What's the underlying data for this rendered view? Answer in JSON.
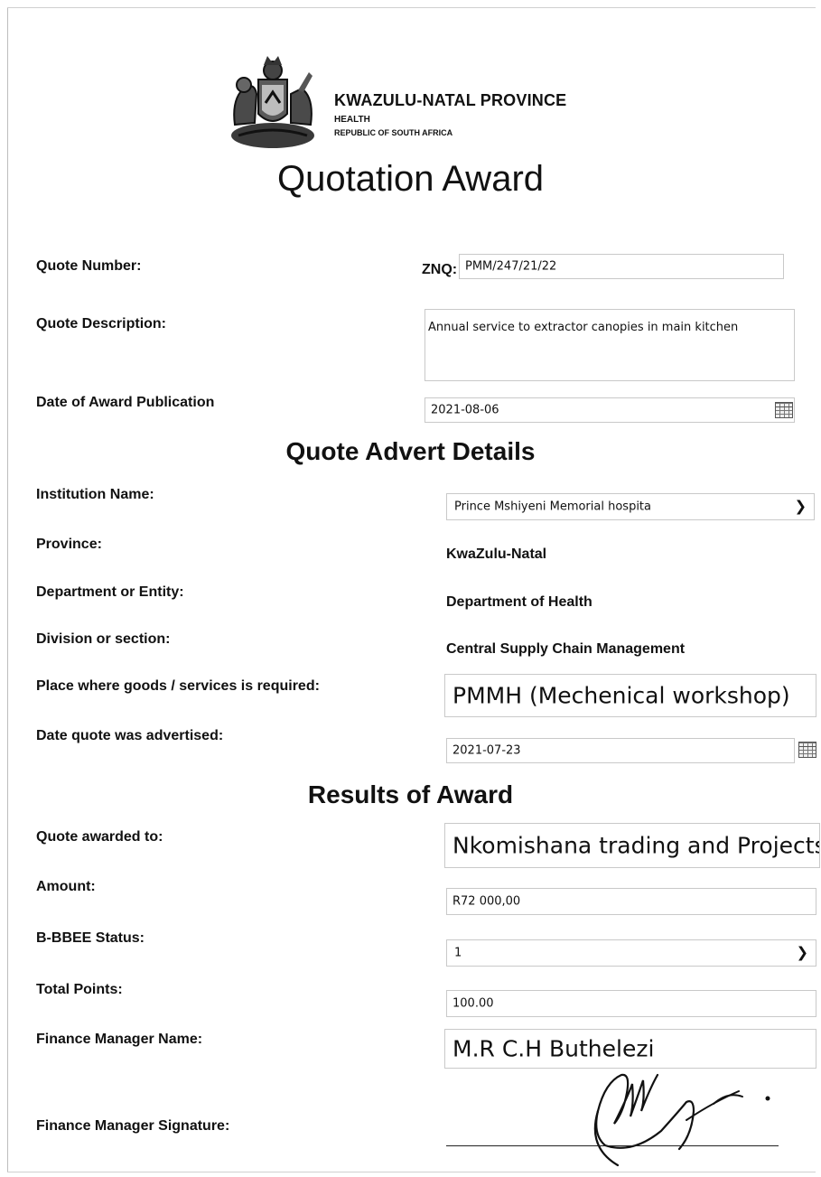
{
  "header": {
    "province": "KWAZULU-NATAL PROVINCE",
    "department": "HEALTH",
    "country": "REPUBLIC OF SOUTH AFRICA",
    "logo_icon": "coat-of-arms-icon"
  },
  "title": "Quotation Award",
  "quote": {
    "number_label": "Quote Number:",
    "number_prefix": "ZNQ:",
    "number_value": "PMM/247/21/22",
    "description_label": "Quote Description:",
    "description_value": "Annual service to extractor canopies in main kitchen",
    "award_date_label": "Date of Award Publication",
    "award_date_value": "2021-08-06"
  },
  "advert": {
    "heading": "Quote Advert Details",
    "institution_label": "Institution Name:",
    "institution_value": "Prince Mshiyeni Memorial hospita",
    "province_label": "Province:",
    "province_value": "KwaZulu-Natal",
    "department_label": "Department or Entity:",
    "department_value": "Department of Health",
    "division_label": "Division or section:",
    "division_value": "Central Supply Chain Management",
    "place_label": "Place where goods /  services is required:",
    "place_value": "PMMH (Mechenical workshop)",
    "advertised_label": "Date quote was advertised:",
    "advertised_value": "2021-07-23"
  },
  "results": {
    "heading": "Results of Award",
    "awarded_label": "Quote awarded to:",
    "awarded_value": "Nkomishana trading and Projects",
    "amount_label": "Amount:",
    "amount_value": "R72 000,00",
    "bbbee_label": "B-BBEE Status:",
    "bbbee_value": "1",
    "points_label": "Total Points:",
    "points_value": "100.00",
    "fm_name_label": "Finance Manager Name:",
    "fm_name_value": "M.R C.H Buthelezi",
    "fm_signature_label": "Finance Manager Signature:"
  },
  "icons": {
    "calendar": "calendar-icon",
    "dropdown": "chevron-down-icon",
    "signature": "handwritten-signature"
  }
}
